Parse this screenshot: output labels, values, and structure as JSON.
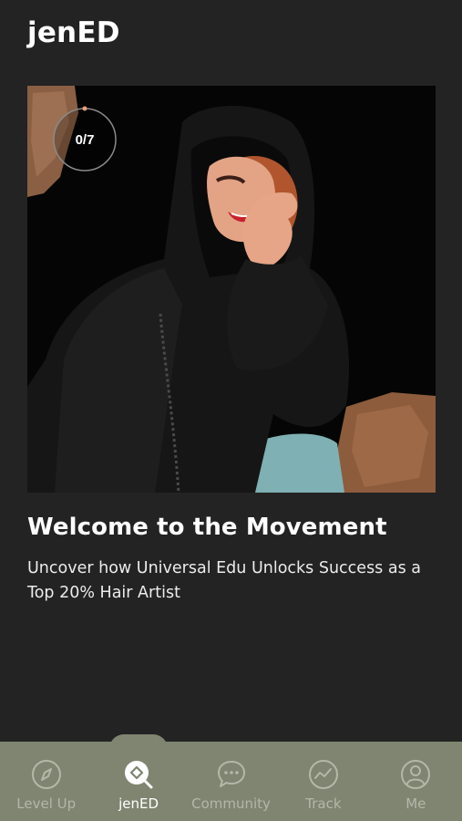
{
  "header": {
    "title": "jenED"
  },
  "hero": {
    "progress_text": "0/7",
    "progress_fraction": 0
  },
  "content": {
    "headline": "Welcome to the Movement",
    "subtitle": "Uncover how Universal Edu Unlocks Success as a Top 20% Hair Artist"
  },
  "tabs": [
    {
      "label": "Level Up",
      "icon": "compass-icon",
      "active": false
    },
    {
      "label": "jenED",
      "icon": "search-diamond-icon",
      "active": true
    },
    {
      "label": "Community",
      "icon": "chat-bubble-icon",
      "active": false
    },
    {
      "label": "Track",
      "icon": "chart-line-icon",
      "active": false
    },
    {
      "label": "Me",
      "icon": "user-icon",
      "active": false
    }
  ],
  "colors": {
    "background": "#232323",
    "tabbar": "#7f8571",
    "progress_accent": "#e8a07a"
  }
}
